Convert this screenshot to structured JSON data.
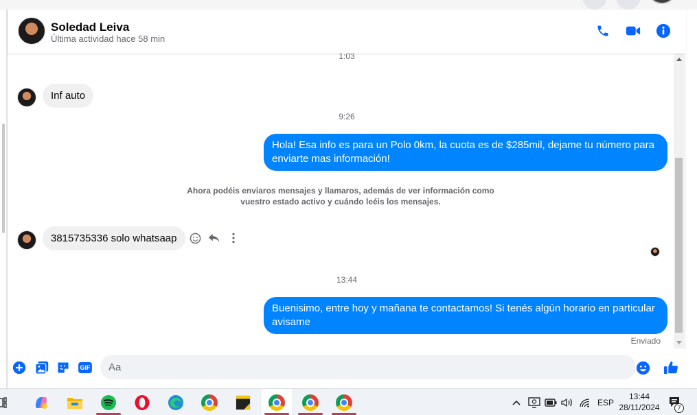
{
  "header": {
    "contact_name": "Soledad Leiva",
    "last_active": "Última actividad hace 58 min",
    "icons": [
      "phone-icon",
      "video-camera-icon",
      "info-icon"
    ]
  },
  "messages": {
    "timestamps": [
      "1:03",
      "9:26",
      "13:44"
    ],
    "items": [
      {
        "direction": "incoming",
        "text": "Inf auto"
      },
      {
        "direction": "outgoing",
        "text": "Hola! Esa info es para un Polo 0km, la cuota es de $285mil, dejame tu número para enviarte mas información!"
      },
      {
        "direction": "system",
        "text": "Ahora podéis enviaros mensajes y llamaros, además de ver información como vuestro estado activo y cuándo leéis los mensajes."
      },
      {
        "direction": "incoming",
        "text": "3815735336 solo whatsaap"
      },
      {
        "direction": "outgoing",
        "text": "Buenisimo, entre hoy y mañana te contactamos! Si tenés algún horario en particular avisame"
      }
    ],
    "sent_status": "Enviado",
    "message_action_icons": [
      "emoji-react-icon",
      "reply-icon",
      "more-options-icon"
    ]
  },
  "composer": {
    "placeholder": "Aa",
    "value": "",
    "icons": [
      "plus-icon",
      "gallery-icon",
      "sticker-icon",
      "gif-icon",
      "emoji-icon",
      "like-icon"
    ],
    "gif_label": "GIF"
  },
  "taskbar": {
    "apps": [
      "task-view-icon",
      "copilot-icon",
      "file-explorer-icon",
      "spotify-icon",
      "opera-icon",
      "edge-icon",
      "chrome-icon",
      "sticky-notes-icon",
      "chrome-icon",
      "chrome-icon",
      "chrome-icon"
    ],
    "language": "ESP",
    "time": "13:44",
    "date": "28/11/2024",
    "notification_count": "7"
  },
  "colors": {
    "accent": "#0084ff",
    "icon_blue": "#0866ff",
    "bubble_incoming": "#f0f0f0",
    "text_secondary": "#65676b"
  }
}
